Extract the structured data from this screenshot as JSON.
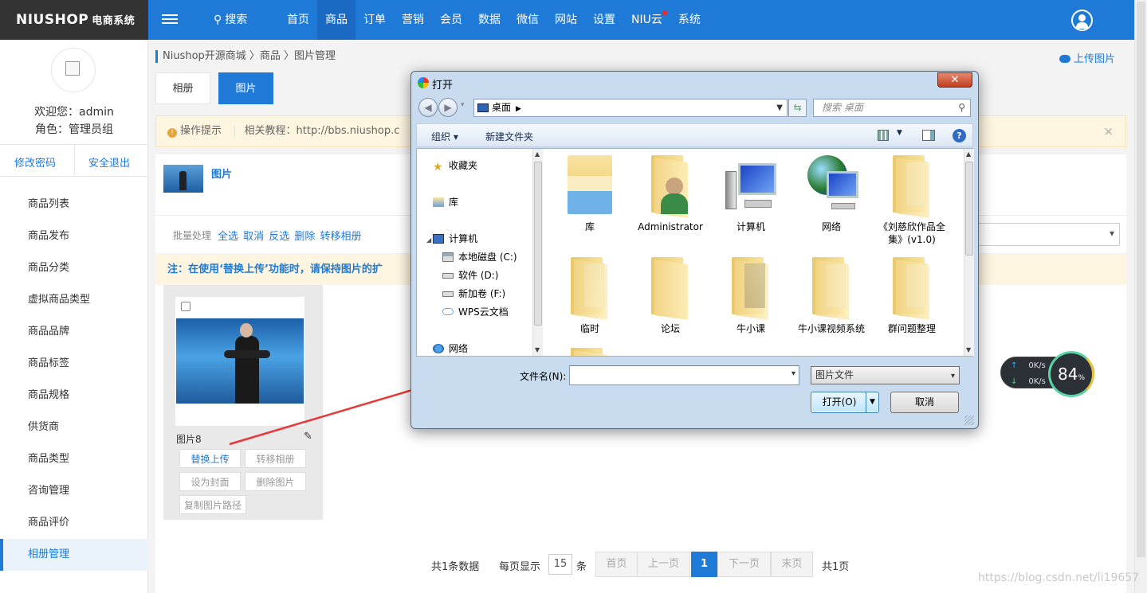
{
  "topbar": {
    "logo": "NIUSHOP",
    "logo_sub": "电商系统",
    "search": "搜索",
    "nav": [
      "首页",
      "商品",
      "订单",
      "营销",
      "会员",
      "数据",
      "微信",
      "网站",
      "设置",
      "NIU云",
      "系统"
    ],
    "active_nav": "商品"
  },
  "sidebar": {
    "welcome": "欢迎您：admin",
    "role": "角色：管理员组",
    "change_password": "修改密码",
    "logout": "安全退出",
    "items": [
      "商品列表",
      "商品发布",
      "商品分类",
      "虚拟商品类型",
      "商品品牌",
      "商品标签",
      "商品规格",
      "供货商",
      "商品类型",
      "咨询管理",
      "商品评价",
      "相册管理"
    ],
    "active_item": "相册管理"
  },
  "content": {
    "breadcrumb": "Niushop开源商城 〉商品 〉图片管理",
    "upload": "上传图片",
    "tabs": [
      "相册",
      "图片"
    ],
    "tip_label": "操作提示",
    "tip_text": "相关教程：http://bbs.niushop.c",
    "tip_close": "×",
    "album_name": "图片",
    "batch_label": "批量处理",
    "batch_actions": "全选 取消 反选 删除 转移相册",
    "note": "注：在使用‘替换上传’功能时，请保持图片的扩",
    "card": {
      "title": "图片8",
      "replace": "替换上传",
      "move": "转移相册",
      "cover": "设为封面",
      "delete": "删除图片",
      "copy_path": "复制图片路径"
    },
    "pager": {
      "total": "共1条数据",
      "per_page_label": "每页显示",
      "per_page": "15",
      "unit": "条",
      "first": "首页",
      "prev": "上一页",
      "current": "1",
      "next": "下一页",
      "last": "末页",
      "pages": "共1页"
    },
    "watermark": "https://blog.csdn.net/li19657"
  },
  "speed_widget": {
    "up": "0K/s",
    "down": "0K/s",
    "percent": "84",
    "percent_unit": "%"
  },
  "dialog": {
    "title": "打开",
    "close": "✕",
    "address": "桌面",
    "search_placeholder": "搜索 桌面",
    "toolbar_organize": "组织 ▾",
    "toolbar_new_folder": "新建文件夹",
    "nav_tree": [
      "收藏夹",
      "库",
      "计算机",
      "本地磁盘 (C:)",
      "软件 (D:)",
      "新加卷 (F:)",
      "WPS云文档",
      "网络"
    ],
    "files": [
      "库",
      "Administrator",
      "计算机",
      "网络",
      "《刘慈欣作品全集》(v1.0)",
      "临时",
      "论坛",
      "牛小课",
      "牛小课视频系统",
      "群问题整理"
    ],
    "filename_label": "文件名(N):",
    "filename_value": "",
    "filetype": "图片文件",
    "open_button": "打开(O)",
    "cancel_button": "取消"
  },
  "colors": {
    "primary": "#1e7ad6",
    "logo_bg": "#333333",
    "tip_bg": "#fdf5e0",
    "arrow": "#e8383a"
  }
}
